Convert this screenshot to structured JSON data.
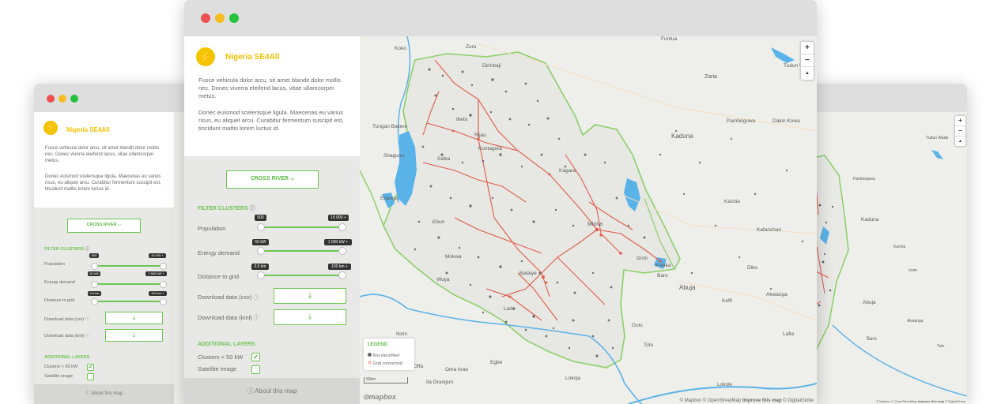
{
  "app": {
    "title": "Nigeria SE4All",
    "intro_p1": "Fusce vehicula dolor arcu, sit amet blandit dolor mollis nec. Donec viverra eleifend lacus, vitae ullamcorper metus.",
    "intro_p2": "Donec euismod scelerisque ligula. Maecenas eu varius risus, eu aliquet arcu. Curabitur fermentum suscipit est, tincidunt mattis lorem luctus id.",
    "state_selector": "CROSS RIVER",
    "filter_heading": "FILTER CLUSTERS",
    "filters": [
      {
        "label": "Population",
        "min": "500",
        "max": "15 000 +"
      },
      {
        "label": "Energy demand",
        "min": "50 kW",
        "max": "1 500 kW +"
      },
      {
        "label": "Distance to grid",
        "min": "0.5 km",
        "max": "100 km +"
      }
    ],
    "download_csv_label": "Download data (csv)",
    "download_kml_label": "Download data (kml)",
    "layers_heading": "ADDITIONAL LAYERS",
    "layers": [
      {
        "label": "Clusters < 50 kW",
        "checked": true
      },
      {
        "label": "Satellite image",
        "checked": false
      }
    ],
    "about_label": "About this map",
    "icons": {
      "info": "info-icon",
      "download": "download-icon",
      "chevron": "chevron-down-icon",
      "bolt": "lightning-bolt-icon",
      "check": "check-icon"
    }
  },
  "map": {
    "zoom_in": "+",
    "zoom_out": "−",
    "compass": "▲",
    "legend_title": "LEGEND",
    "legend_items": [
      {
        "label": "Not electrified",
        "color": "#666666"
      },
      {
        "label": "Grid connected",
        "color": "#f3c9c4"
      }
    ],
    "scale_label": "50km",
    "logo": "mapbox",
    "attribution": "© Mapbox © OpenStreetMap",
    "attribution_link": "Improve this map",
    "attribution_tail": "© DigitalGlobe",
    "places": [
      "Koko",
      "Zuru",
      "Funtua",
      "Dirinbaji",
      "Tudun Wada",
      "Zaria",
      "Pambeguwa",
      "Dakin Kowa",
      "Tungan Bakere",
      "Shagunu",
      "Ibeto",
      "Rijau",
      "Kontagora",
      "Salka",
      "Kaduna",
      "Kagara",
      "Ebanga",
      "Kachia",
      "Ebun",
      "Minna",
      "Kafanchan",
      "Mokwa",
      "Izom",
      "Diko",
      "Kwaka",
      "Bataiye",
      "Wuya",
      "Baro",
      "Abuja",
      "Keffi",
      "Akwanga",
      "Lade",
      "Gulu",
      "Lafia",
      "Ilorin",
      "Toto",
      "Offa",
      "Oma Aran",
      "Egbe",
      "Ila Orangun",
      "Lokoja",
      "Lokole"
    ]
  },
  "colors": {
    "accent": "#6cc653",
    "brand": "#f5c400",
    "grid": "#e05c48",
    "water": "#5ab3e8",
    "boundary": "#8bd068"
  }
}
